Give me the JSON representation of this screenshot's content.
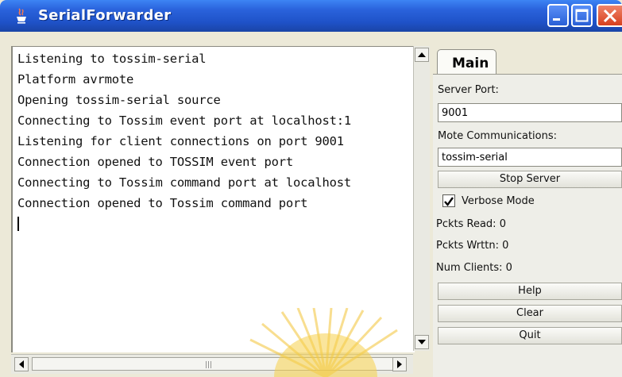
{
  "window": {
    "title": "SerialForwarder",
    "app_icon": "java-cup-icon"
  },
  "log": {
    "lines": [
      "Listening to tossim-serial",
      "Platform avrmote",
      "Opening tossim-serial source",
      "Connecting to Tossim event port at localhost:1",
      "Listening for client connections on port 9001",
      "Connection opened to TOSSIM event port",
      "Connecting to Tossim command port at localhost",
      "Connection opened to Tossim command port"
    ]
  },
  "panel": {
    "tab_label": "Main",
    "server_port_label": "Server Port:",
    "server_port_value": "9001",
    "mote_comm_label": "Mote Communications:",
    "mote_comm_value": "tossim-serial",
    "stop_server_label": "Stop Server",
    "verbose_label": "Verbose Mode",
    "verbose_checked": true,
    "pckts_read": "Pckts Read: 0",
    "pckts_wrttn": "Pckts Wrttn: 0",
    "num_clients": "Num Clients: 0",
    "help_label": "Help",
    "clear_label": "Clear",
    "quit_label": "Quit"
  },
  "colors": {
    "titlebar": "#2a63dc",
    "close_button": "#d6401e"
  }
}
